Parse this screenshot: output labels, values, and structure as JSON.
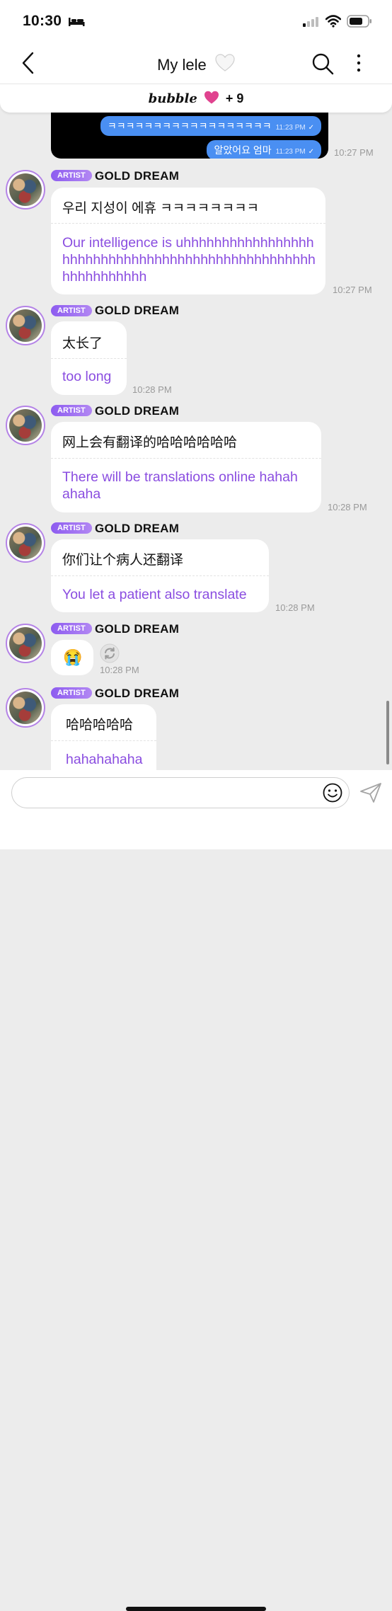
{
  "status_bar": {
    "time": "10:30"
  },
  "nav": {
    "title": "My lele"
  },
  "banner": {
    "label": "bubble",
    "count": "+ 9"
  },
  "shot": {
    "bubble1_text": "ㅋㅋㅋㅋㅋㅋㅋㅋㅋㅋㅋㅋㅋㅋㅋㅋㅋㅋ",
    "bubble1_time": "11:23 PM",
    "bubble2_text": "알았어요 엄마",
    "bubble2_time": "11:23 PM",
    "time": "10:27 PM"
  },
  "messages": [
    {
      "badge": "ARTIST",
      "sender": "GOLD DREAM",
      "original": "우리 지성이 에휴 ㅋㅋㅋㅋㅋㅋㅋㅋ",
      "translation": "Our intelligence is uhhhhhhhhhhhhhhhhhhhhhhhhhhhhhhhhhhhhhhhhhhhhhhhhhhhhhhhhhhhhh",
      "time": "10:27 PM"
    },
    {
      "badge": "ARTIST",
      "sender": "GOLD DREAM",
      "original": "太长了",
      "translation": "too long",
      "time": "10:28 PM"
    },
    {
      "badge": "ARTIST",
      "sender": "GOLD DREAM",
      "original": "网上会有翻译的哈哈哈哈哈哈",
      "translation": "There will be translations online hahah ahaha",
      "time": "10:28 PM"
    },
    {
      "badge": "ARTIST",
      "sender": "GOLD DREAM",
      "original": "你们让个病人还翻译",
      "translation": "You let a patient also translate",
      "time": "10:28 PM"
    },
    {
      "badge": "ARTIST",
      "sender": "GOLD DREAM",
      "original": "😭",
      "time": "10:28 PM"
    },
    {
      "badge": "ARTIST",
      "sender": "GOLD DREAM",
      "original": "哈哈哈哈哈",
      "translation": "hahahahaha"
    }
  ],
  "input": {
    "placeholder": ""
  },
  "colors": {
    "accent": "#8a4de0",
    "badge": "#9b6bf2",
    "bubble_blue": "#4a8ff2"
  }
}
